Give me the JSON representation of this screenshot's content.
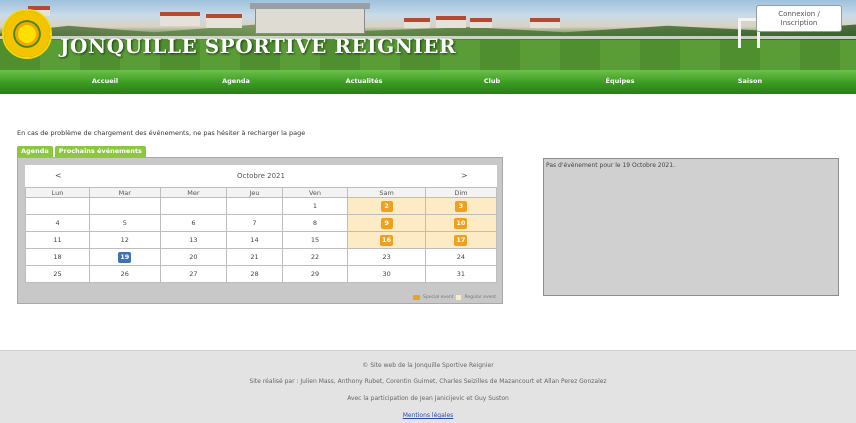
{
  "header": {
    "site_title": "JONQUILLE SPORTIVE REIGNIER",
    "login_line1": "Connexion /",
    "login_line2": "Inscription"
  },
  "nav": {
    "items": [
      "Accueil",
      "Agenda",
      "Actualités",
      "Club",
      "Équipes",
      "Saison"
    ]
  },
  "notice": "En cas de problème de chargement des événements, ne pas hésiter à recharger la page",
  "tabs": [
    "Agenda",
    "Prochains événements"
  ],
  "calendar": {
    "prev": "<",
    "next": ">",
    "month": "Octobre 2021",
    "weekdays": [
      "Lun",
      "Mar",
      "Mer",
      "Jeu",
      "Ven",
      "Sam",
      "Dim"
    ],
    "weeks": [
      [
        "",
        "",
        "",
        "",
        "1",
        "2",
        "3"
      ],
      [
        "4",
        "5",
        "6",
        "7",
        "8",
        "9",
        "10"
      ],
      [
        "11",
        "12",
        "13",
        "14",
        "15",
        "16",
        "17"
      ],
      [
        "18",
        "19",
        "20",
        "21",
        "22",
        "23",
        "24"
      ],
      [
        "25",
        "26",
        "27",
        "28",
        "29",
        "30",
        "31"
      ]
    ],
    "event_days": [
      "2",
      "3",
      "9",
      "10",
      "16",
      "17"
    ],
    "today": "19",
    "legend_special": "Special event",
    "legend_regular": "Regular event"
  },
  "event_panel": "Pas d'événement pour le 19 Octobre 2021.",
  "footer": {
    "line1": "© Site web de la Jonquille Sportive Reignier",
    "line2": "Site réalisé par : Julien Mass, Anthony Rubet, Corentin Guimet, Charles Seizilles de Mazancourt et Allan Perez Gonzalez",
    "line3": "Avec la participation de Jean Janicijevic et Guy Suston",
    "legal_link": "Mentions légales"
  },
  "colors": {
    "nav_green": "#3a9a22",
    "event_orange": "#f0a020",
    "today_blue": "#3f73b0",
    "weekend_bg": "#fcebc4"
  }
}
